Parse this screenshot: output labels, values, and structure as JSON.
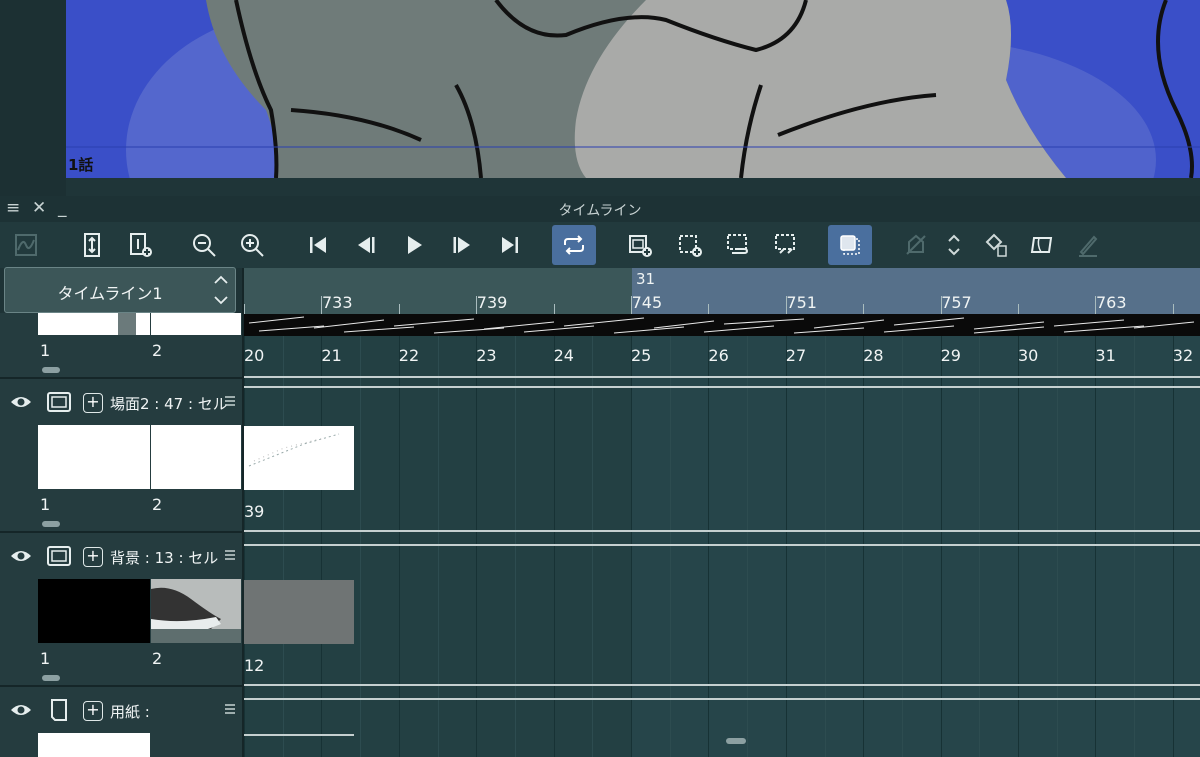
{
  "canvas": {
    "episode_label": "1話"
  },
  "panel": {
    "title": "タイムライン"
  },
  "timeline_select": {
    "label": "タイムライン1"
  },
  "ruler": {
    "current_frame": "31",
    "ticks": [
      {
        "label": "733"
      },
      {
        "label": "739"
      },
      {
        "label": "745"
      },
      {
        "label": "751"
      },
      {
        "label": "757"
      },
      {
        "label": "763"
      }
    ]
  },
  "top_track": {
    "left_frames": [
      "1",
      "2"
    ],
    "frames": [
      "20",
      "21",
      "22",
      "23",
      "24",
      "25",
      "26",
      "27",
      "28",
      "29",
      "30",
      "31",
      "32"
    ]
  },
  "layers": [
    {
      "name": "場面2 : 47 : セル",
      "frames": [
        "1",
        "2"
      ],
      "cel_label": "39"
    },
    {
      "name": "背景 : 13 : セル",
      "frames": [
        "1",
        "2"
      ],
      "cel_label": "12"
    },
    {
      "name": "用紙 :"
    }
  ],
  "toolbar": {
    "buttons": [
      {
        "icon": "graph-icon"
      },
      {
        "icon": "fit-frames-icon"
      },
      {
        "icon": "add-frame-icon"
      },
      {
        "icon": "zoom-out-icon"
      },
      {
        "icon": "zoom-in-icon"
      },
      {
        "icon": "first-frame-icon"
      },
      {
        "icon": "prev-frame-icon"
      },
      {
        "icon": "play-icon"
      },
      {
        "icon": "next-frame-icon"
      },
      {
        "icon": "last-frame-icon"
      },
      {
        "icon": "loop-icon"
      },
      {
        "icon": "new-animation-folder-icon"
      },
      {
        "icon": "new-cel-icon"
      },
      {
        "icon": "link-cel-icon"
      },
      {
        "icon": "unlink-cel-icon"
      },
      {
        "icon": "onion-skin-icon"
      },
      {
        "icon": "cel-move-icon"
      },
      {
        "icon": "up-down-icon"
      },
      {
        "icon": "delete-cel-icon"
      },
      {
        "icon": "edit-timeline-icon"
      },
      {
        "icon": "pen-icon"
      }
    ]
  },
  "colors": {
    "panel_bg": "#223a3d",
    "active_button": "#4a6f9e",
    "ruler_highlight": "#56708a",
    "canvas_blue": "#3a4fc8"
  }
}
